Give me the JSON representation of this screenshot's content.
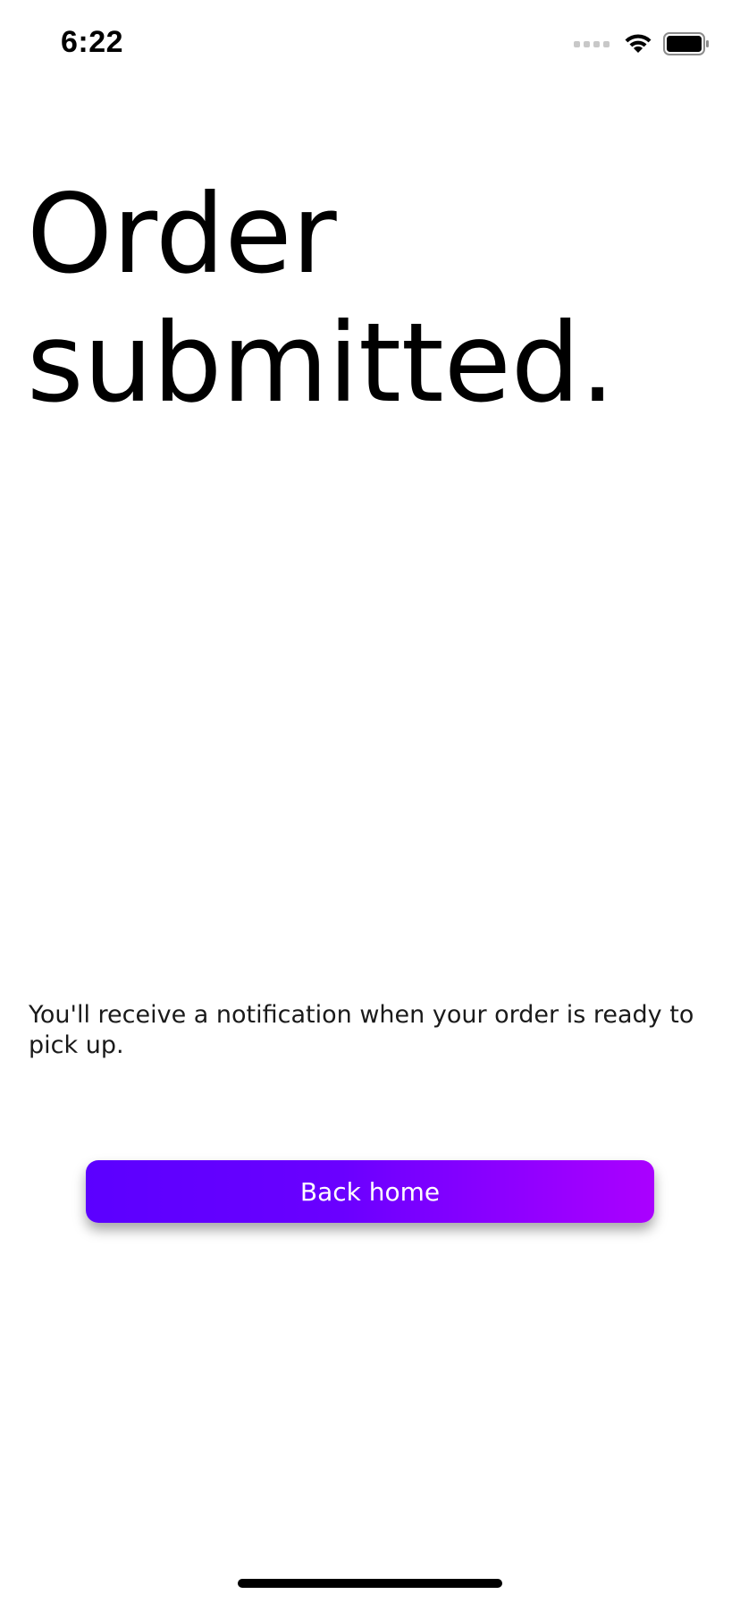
{
  "status_bar": {
    "time": "6:22",
    "icons": [
      "cellular-signal-icon",
      "wifi-icon",
      "battery-icon"
    ]
  },
  "main": {
    "title": "Order submitted.",
    "message": "You'll receive a notification when your order is ready to pick up.",
    "button_label": "Back home"
  },
  "colors": {
    "button_gradient_start": "#5b00ff",
    "button_gradient_end": "#aa00ff",
    "button_text": "#ffffff",
    "background": "#ffffff",
    "text": "#000000"
  }
}
